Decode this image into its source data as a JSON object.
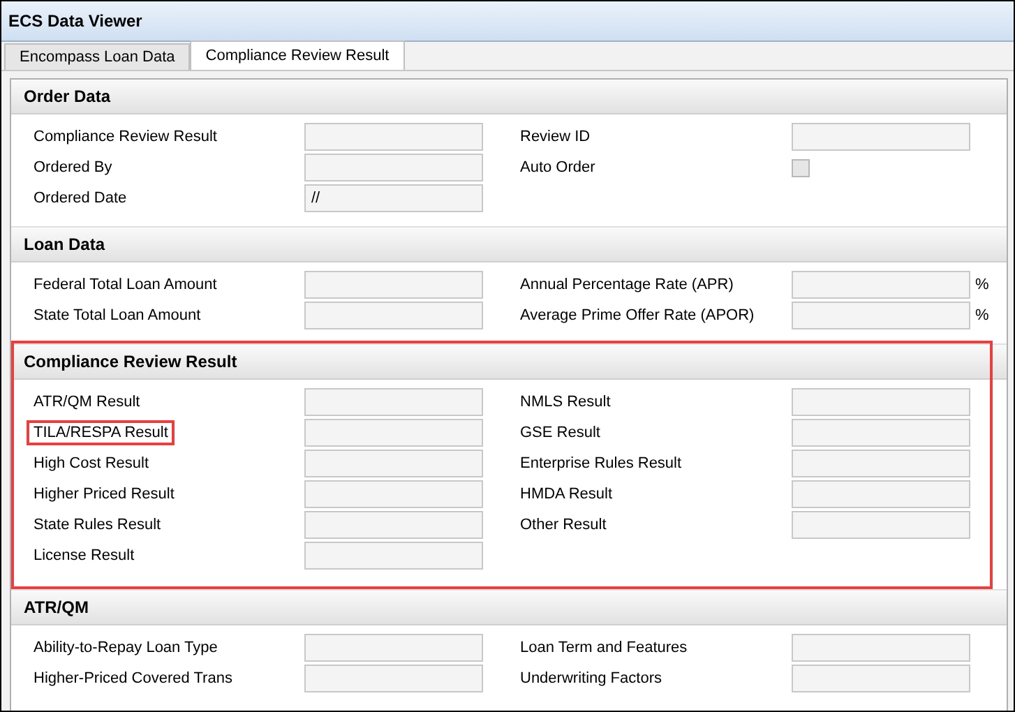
{
  "window": {
    "title": "ECS Data Viewer"
  },
  "tabs": [
    {
      "label": "Encompass Loan Data",
      "selected": false
    },
    {
      "label": "Compliance Review Result",
      "selected": true
    }
  ],
  "sections": [
    {
      "title": "Order Data",
      "highlighted": false,
      "rows": [
        [
          {
            "label": "Compliance Review Result",
            "kind": "text"
          },
          {
            "label": "Review ID",
            "kind": "text"
          }
        ],
        [
          {
            "label": "Ordered By",
            "kind": "text"
          },
          {
            "label": "Auto Order",
            "kind": "checkbox",
            "checked": false
          }
        ],
        [
          {
            "label": "Ordered Date",
            "kind": "text",
            "value": "//"
          }
        ]
      ]
    },
    {
      "title": "Loan Data",
      "highlighted": false,
      "rows": [
        [
          {
            "label": "Federal Total Loan Amount",
            "kind": "text"
          },
          {
            "label": "Annual Percentage Rate (APR)",
            "kind": "text",
            "unit": "%"
          }
        ],
        [
          {
            "label": "State Total Loan Amount",
            "kind": "text"
          },
          {
            "label": "Average Prime Offer Rate (APOR)",
            "kind": "text",
            "unit": "%"
          }
        ]
      ]
    },
    {
      "title": "Compliance Review Result",
      "highlighted": true,
      "rows": [
        [
          {
            "label": "ATR/QM Result",
            "kind": "text"
          },
          {
            "label": "NMLS Result",
            "kind": "text"
          }
        ],
        [
          {
            "label": "TILA/RESPA Result",
            "kind": "text",
            "highlighted": true
          },
          {
            "label": "GSE Result",
            "kind": "text"
          }
        ],
        [
          {
            "label": "High Cost Result",
            "kind": "text"
          },
          {
            "label": "Enterprise Rules Result",
            "kind": "text"
          }
        ],
        [
          {
            "label": "Higher Priced Result",
            "kind": "text"
          },
          {
            "label": "HMDA Result",
            "kind": "text"
          }
        ],
        [
          {
            "label": "State Rules Result",
            "kind": "text"
          },
          {
            "label": "Other Result",
            "kind": "text"
          }
        ],
        [
          {
            "label": "License Result",
            "kind": "text"
          }
        ]
      ]
    },
    {
      "title": "ATR/QM",
      "highlighted": false,
      "rows": [
        [
          {
            "label": "Ability-to-Repay Loan Type",
            "kind": "text"
          },
          {
            "label": "Loan Term and Features",
            "kind": "text"
          }
        ],
        [
          {
            "label": "Higher-Priced Covered Trans",
            "kind": "text"
          },
          {
            "label": "Underwriting Factors",
            "kind": "text"
          }
        ]
      ]
    }
  ]
}
